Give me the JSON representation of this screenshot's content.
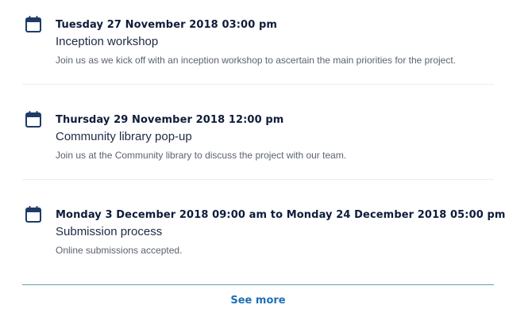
{
  "events": [
    {
      "icon": "calendar-icon",
      "date": "Tuesday 27 November 2018 03:00 pm",
      "title": "Inception workshop",
      "description": "Join us as we kick off with an inception workshop to ascertain the main priorities for the project."
    },
    {
      "icon": "calendar-icon",
      "date": "Thursday 29 November 2018 12:00 pm",
      "title": "Community library pop-up",
      "description": "Join us at the Community library to discuss the project with our team."
    },
    {
      "icon": "calendar-icon",
      "date": "Monday 3 December 2018 09:00 am to Monday 24 December 2018 05:00 pm",
      "title": "Submission process",
      "description": "Online submissions accepted."
    }
  ],
  "see_more_label": "See more",
  "colors": {
    "icon": "#1f3b66",
    "date_text": "#0f1d3a",
    "link": "#1f6fb5",
    "accent_rule": "#5aa7a8"
  }
}
